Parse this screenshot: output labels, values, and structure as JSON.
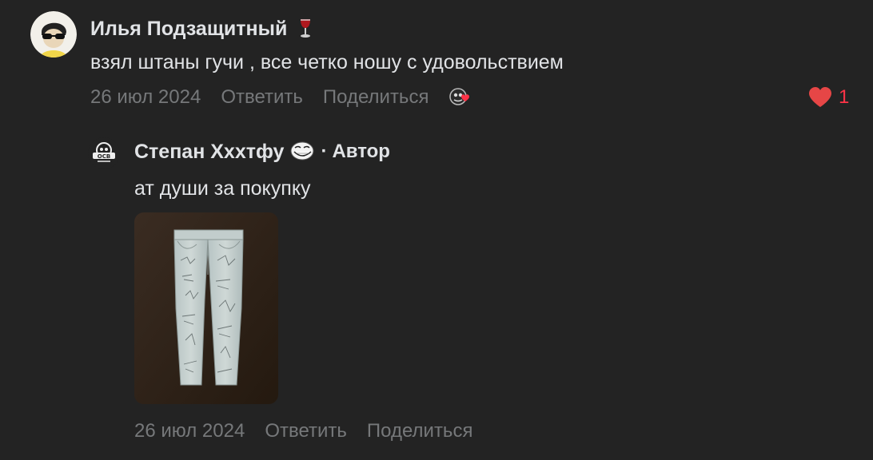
{
  "comment": {
    "author": "Илья Подзащитный",
    "author_emoji": "wine-glass-icon",
    "text": "взял штаны гучи , все четко ношу с удовольствием",
    "date": "26 июл 2024",
    "reply_label": "Ответить",
    "share_label": "Поделиться",
    "reaction_icon": "reaction-heart-icon",
    "likes_count": "1",
    "like_color": "#e64646"
  },
  "reply": {
    "author": "Степан Хххтфу",
    "author_emoji": "trollface-icon",
    "separator": "·",
    "badge": "Автор",
    "text": "ат души за покупку",
    "photo_icon": "jeans-photo",
    "date": "26 июл 2024",
    "reply_label": "Ответить",
    "share_label": "Поделиться"
  },
  "colors": {
    "background": "#232323",
    "text_primary": "#e1e3e6",
    "text_secondary": "#76787a",
    "accent_red": "#ff3347"
  }
}
